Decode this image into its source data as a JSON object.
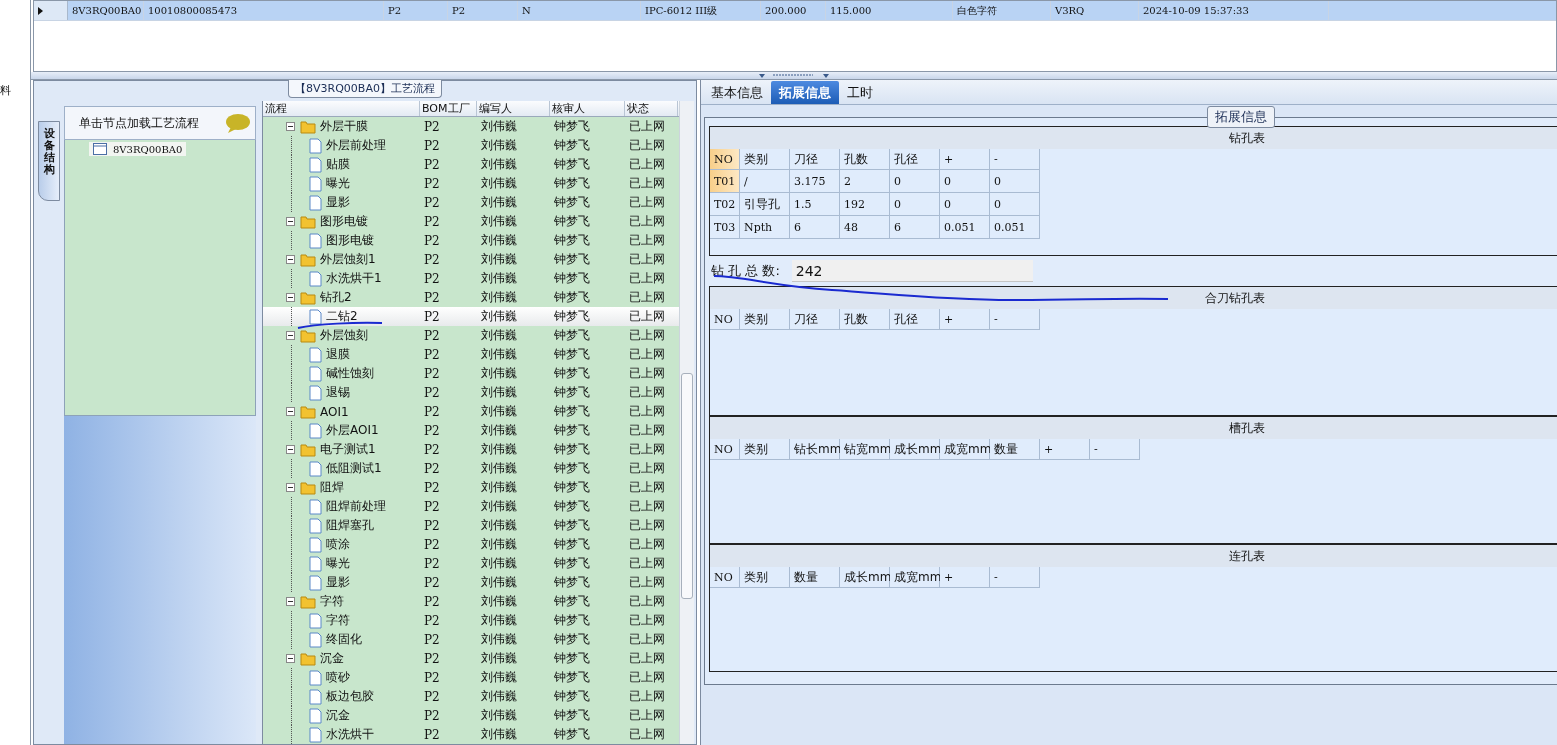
{
  "left_edge_text": "料",
  "record_grid": {
    "rows": [
      {
        "selected": true,
        "cells": [
          "8V3RQ00BA0",
          "10010800085473",
          "P2",
          "P2",
          "N",
          "IPC-6012 III级",
          "200.000",
          "115.000",
          "白色字符",
          "V3RQ",
          "2024-10-09 15:37:33"
        ]
      }
    ]
  },
  "flow_panel": {
    "title": "【8V3RQ00BA0】工艺流程",
    "side_tab": "设备结构",
    "node_header": "单击节点加载工艺流程",
    "nodes": [
      {
        "label": "8V3RQ00BA0"
      }
    ],
    "columns": [
      "流程",
      "BOM工厂",
      "编写人",
      "核审人",
      "状态"
    ],
    "tree": [
      {
        "name": "外层干膜",
        "bom": "P2",
        "writer": "刘伟巍",
        "reviewer": "钟梦飞",
        "status": "已上网",
        "selected": false,
        "expanded": true,
        "children": [
          {
            "name": "外层前处理",
            "bom": "P2",
            "writer": "刘伟巍",
            "reviewer": "钟梦飞",
            "status": "已上网",
            "selected": false
          },
          {
            "name": "贴膜",
            "bom": "P2",
            "writer": "刘伟巍",
            "reviewer": "钟梦飞",
            "status": "已上网",
            "selected": false
          },
          {
            "name": "曝光",
            "bom": "P2",
            "writer": "刘伟巍",
            "reviewer": "钟梦飞",
            "status": "已上网",
            "selected": false
          },
          {
            "name": "显影",
            "bom": "P2",
            "writer": "刘伟巍",
            "reviewer": "钟梦飞",
            "status": "已上网",
            "selected": false
          }
        ]
      },
      {
        "name": "图形电镀",
        "bom": "P2",
        "writer": "刘伟巍",
        "reviewer": "钟梦飞",
        "status": "已上网",
        "selected": false,
        "expanded": true,
        "children": [
          {
            "name": "图形电镀",
            "bom": "P2",
            "writer": "刘伟巍",
            "reviewer": "钟梦飞",
            "status": "已上网",
            "selected": false
          }
        ]
      },
      {
        "name": "外层蚀刻1",
        "bom": "P2",
        "writer": "刘伟巍",
        "reviewer": "钟梦飞",
        "status": "已上网",
        "selected": false,
        "expanded": true,
        "children": [
          {
            "name": "水洗烘干1",
            "bom": "P2",
            "writer": "刘伟巍",
            "reviewer": "钟梦飞",
            "status": "已上网",
            "selected": false
          }
        ]
      },
      {
        "name": "钻孔2",
        "bom": "P2",
        "writer": "刘伟巍",
        "reviewer": "钟梦飞",
        "status": "已上网",
        "selected": false,
        "expanded": true,
        "children": [
          {
            "name": "二钻2",
            "bom": "P2",
            "writer": "刘伟巍",
            "reviewer": "钟梦飞",
            "status": "已上网",
            "selected": true
          }
        ]
      },
      {
        "name": "外层蚀刻",
        "bom": "P2",
        "writer": "刘伟巍",
        "reviewer": "钟梦飞",
        "status": "已上网",
        "selected": false,
        "expanded": true,
        "children": [
          {
            "name": "退膜",
            "bom": "P2",
            "writer": "刘伟巍",
            "reviewer": "钟梦飞",
            "status": "已上网",
            "selected": false
          },
          {
            "name": "碱性蚀刻",
            "bom": "P2",
            "writer": "刘伟巍",
            "reviewer": "钟梦飞",
            "status": "已上网",
            "selected": false
          },
          {
            "name": "退锡",
            "bom": "P2",
            "writer": "刘伟巍",
            "reviewer": "钟梦飞",
            "status": "已上网",
            "selected": false
          }
        ]
      },
      {
        "name": "AOI1",
        "bom": "P2",
        "writer": "刘伟巍",
        "reviewer": "钟梦飞",
        "status": "已上网",
        "selected": false,
        "expanded": true,
        "children": [
          {
            "name": "外层AOI1",
            "bom": "P2",
            "writer": "刘伟巍",
            "reviewer": "钟梦飞",
            "status": "已上网",
            "selected": false
          }
        ]
      },
      {
        "name": "电子测试1",
        "bom": "P2",
        "writer": "刘伟巍",
        "reviewer": "钟梦飞",
        "status": "已上网",
        "selected": false,
        "expanded": true,
        "children": [
          {
            "name": "低阻测试1",
            "bom": "P2",
            "writer": "刘伟巍",
            "reviewer": "钟梦飞",
            "status": "已上网",
            "selected": false
          }
        ]
      },
      {
        "name": "阻焊",
        "bom": "P2",
        "writer": "刘伟巍",
        "reviewer": "钟梦飞",
        "status": "已上网",
        "selected": false,
        "expanded": true,
        "children": [
          {
            "name": "阻焊前处理",
            "bom": "P2",
            "writer": "刘伟巍",
            "reviewer": "钟梦飞",
            "status": "已上网",
            "selected": false
          },
          {
            "name": "阻焊塞孔",
            "bom": "P2",
            "writer": "刘伟巍",
            "reviewer": "钟梦飞",
            "status": "已上网",
            "selected": false
          },
          {
            "name": "喷涂",
            "bom": "P2",
            "writer": "刘伟巍",
            "reviewer": "钟梦飞",
            "status": "已上网",
            "selected": false
          },
          {
            "name": "曝光",
            "bom": "P2",
            "writer": "刘伟巍",
            "reviewer": "钟梦飞",
            "status": "已上网",
            "selected": false
          },
          {
            "name": "显影",
            "bom": "P2",
            "writer": "刘伟巍",
            "reviewer": "钟梦飞",
            "status": "已上网",
            "selected": false
          }
        ]
      },
      {
        "name": "字符",
        "bom": "P2",
        "writer": "刘伟巍",
        "reviewer": "钟梦飞",
        "status": "已上网",
        "selected": false,
        "expanded": true,
        "children": [
          {
            "name": "字符",
            "bom": "P2",
            "writer": "刘伟巍",
            "reviewer": "钟梦飞",
            "status": "已上网",
            "selected": false
          },
          {
            "name": "终固化",
            "bom": "P2",
            "writer": "刘伟巍",
            "reviewer": "钟梦飞",
            "status": "已上网",
            "selected": false
          }
        ]
      },
      {
        "name": "沉金",
        "bom": "P2",
        "writer": "刘伟巍",
        "reviewer": "钟梦飞",
        "status": "已上网",
        "selected": false,
        "expanded": true,
        "children": [
          {
            "name": "喷砂",
            "bom": "P2",
            "writer": "刘伟巍",
            "reviewer": "钟梦飞",
            "status": "已上网",
            "selected": false
          },
          {
            "name": "板边包胶",
            "bom": "P2",
            "writer": "刘伟巍",
            "reviewer": "钟梦飞",
            "status": "已上网",
            "selected": false
          },
          {
            "name": "沉金",
            "bom": "P2",
            "writer": "刘伟巍",
            "reviewer": "钟梦飞",
            "status": "已上网",
            "selected": false
          },
          {
            "name": "水洗烘干",
            "bom": "P2",
            "writer": "刘伟巍",
            "reviewer": "钟梦飞",
            "status": "已上网",
            "selected": false
          }
        ]
      }
    ]
  },
  "detail_panel": {
    "tabs": [
      {
        "label": "基本信息",
        "selected": false
      },
      {
        "label": "拓展信息",
        "selected": true
      },
      {
        "label": "工时",
        "selected": false
      }
    ],
    "group_title": "拓展信息",
    "blocks": [
      {
        "kind": "table",
        "title": "钻孔表",
        "columns": [
          "NO",
          "类别",
          "刀径",
          "孔数",
          "孔径",
          "+",
          "-"
        ],
        "rows": [
          {
            "current": true,
            "cells": [
              "T01",
              "/",
              "3.175",
              "2",
              "0",
              "0",
              "0"
            ]
          },
          {
            "current": false,
            "cells": [
              "T02",
              "引导孔",
              "1.5",
              "192",
              "0",
              "0",
              "0"
            ]
          },
          {
            "current": false,
            "cells": [
              "T03",
              "Npth",
              "6",
              "48",
              "6",
              "0.051",
              "0.051"
            ]
          }
        ]
      },
      {
        "kind": "total",
        "label": "钻 孔 总 数:",
        "value": "242"
      },
      {
        "kind": "table",
        "title": "合刀钻孔表",
        "columns": [
          "NO",
          "类别",
          "刀径",
          "孔数",
          "孔径",
          "+",
          "-"
        ]
      },
      {
        "kind": "table",
        "title": "槽孔表",
        "columns": [
          "NO",
          "类别",
          "钻长mm",
          "钻宽mm",
          "成长mm",
          "成宽mm",
          "数量",
          "+",
          "-"
        ]
      },
      {
        "kind": "table",
        "title": "连孔表",
        "columns": [
          "NO",
          "类别",
          "数量",
          "成长mm",
          "成宽mm",
          "+",
          "-"
        ]
      }
    ]
  }
}
